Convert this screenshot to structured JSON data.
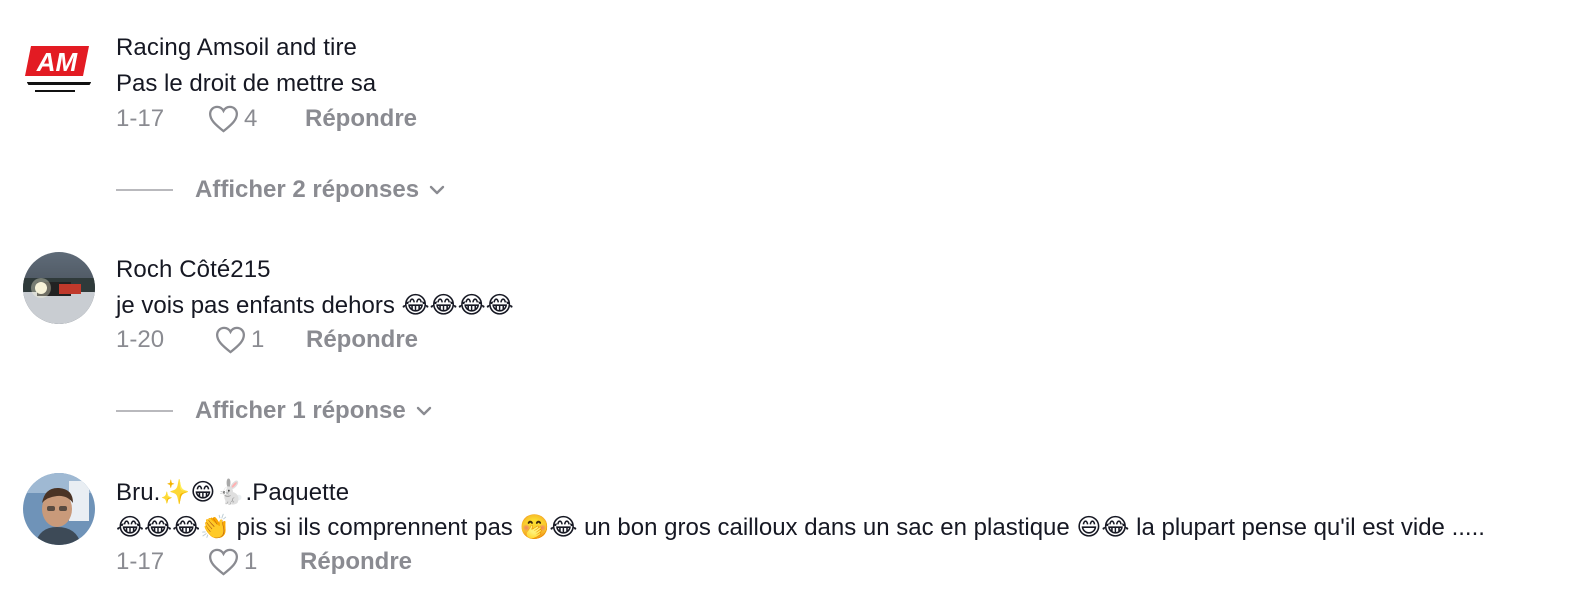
{
  "comments": [
    {
      "username": "Racing Amsoil and tire",
      "text": "Pas le droit de mettre sa",
      "date": "1-17",
      "likes": "4",
      "reply_label": "Répondre",
      "replies_label": "Afficher 2 réponses",
      "avatar": "amsoil-logo",
      "avatar_text": "AM"
    },
    {
      "username": "Roch Côté215",
      "text": "je vois pas enfants dehors 😂😂😂😂",
      "date": "1-20",
      "likes": "1",
      "reply_label": "Répondre",
      "replies_label": "Afficher 1 réponse",
      "avatar": "snowy-truck-photo"
    },
    {
      "username": "Bru.✨😁🐇.Paquette",
      "text": "😂😂😂👏 pis si ils comprennent pas 🤭😂 un bon gros cailloux dans un sac en plastique 😄😂 la plupart pense qu'il est vide .....",
      "date": "1-17",
      "likes": "1",
      "reply_label": "Répondre",
      "avatar": "person-photo"
    }
  ],
  "colors": {
    "text_primary": "#161823",
    "text_secondary": "#8a8b91",
    "brand_red": "#e31b23"
  }
}
